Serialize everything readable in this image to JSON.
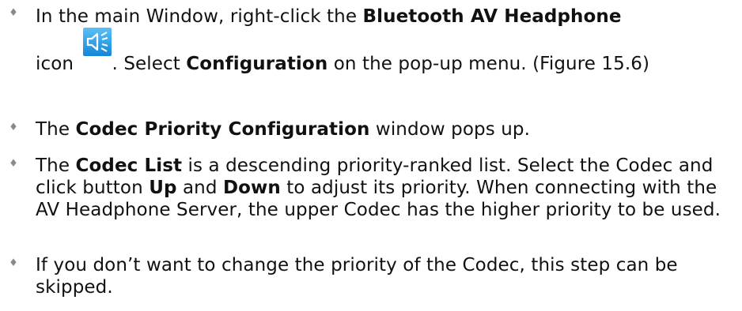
{
  "bullets": [
    {
      "icon": "bluetooth-av-headphone-icon",
      "parts": {
        "a": "In the main Window, right-click the ",
        "b": "Bluetooth AV Headphone",
        "c": "icon ",
        "d": ". Select ",
        "e": "Configuration",
        "f": " on the pop-up menu. (Figure 15.6)"
      }
    },
    {
      "parts": {
        "a": "The ",
        "b": "Codec Priority Configuration",
        "c": " window pops up."
      }
    },
    {
      "parts": {
        "a": "The ",
        "b": "Codec List",
        "c": " is a descending priority-ranked list. Select the Codec and click button ",
        "d": "Up",
        "e": " and ",
        "f": "Down",
        "g": " to adjust its priority. When connecting with the AV Headphone Server, the upper Codec has the higher priority to be used."
      }
    },
    {
      "parts": {
        "a": "If you don’t want to change the priority of the Codec, this step can be skipped."
      }
    }
  ],
  "marker": "♦",
  "colors": {
    "text": "#111111",
    "marker": "#8a8a8a",
    "icon_bg_top": "#4fb3f0",
    "icon_bg_bottom": "#1a8fdc"
  }
}
